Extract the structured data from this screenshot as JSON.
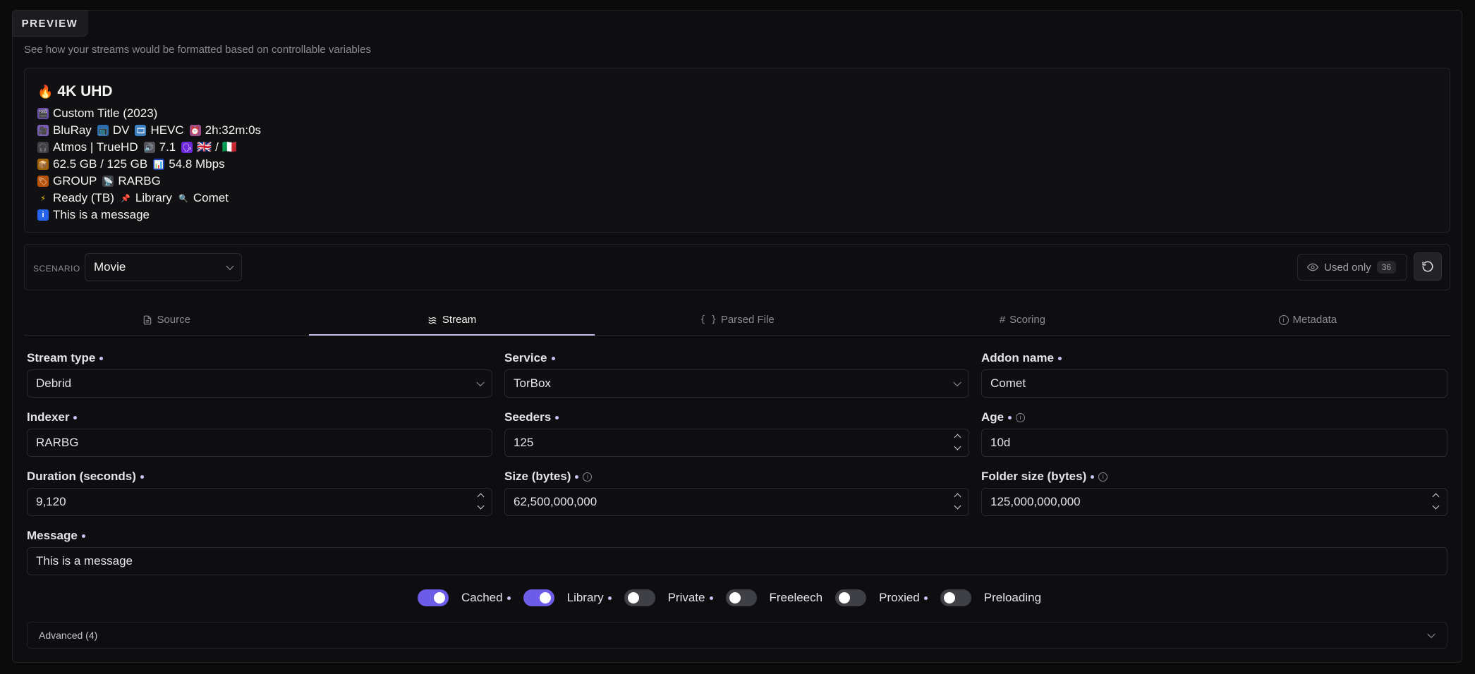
{
  "panel": {
    "tab_label": "PREVIEW",
    "subtitle": "See how your streams would be formatted based on controllable variables"
  },
  "preview": {
    "title": "4K UHD",
    "lines": [
      [
        "Custom Title (2023)"
      ],
      [
        "BluRay",
        "DV",
        "HEVC",
        "2h:32m:0s"
      ],
      [
        "Atmos | TrueHD",
        "7.1",
        "🇬🇧 / 🇮🇹"
      ],
      [
        "62.5 GB / 125 GB",
        "54.8 Mbps"
      ],
      [
        "GROUP",
        "RARBG"
      ],
      [
        "Ready (TB)",
        "Library",
        "Comet"
      ],
      [
        "This is a message"
      ]
    ]
  },
  "scenario": {
    "label": "SCENARIO",
    "value": "Movie",
    "used_only_label": "Used only",
    "used_only_count": "36"
  },
  "tabs": [
    {
      "label": "Source",
      "icon": "file-icon"
    },
    {
      "label": "Stream",
      "icon": "waves-icon",
      "active": true
    },
    {
      "label": "Parsed File",
      "icon": "braces-icon"
    },
    {
      "label": "Scoring",
      "icon": "hash-icon"
    },
    {
      "label": "Metadata",
      "icon": "info-icon"
    }
  ],
  "fields": {
    "stream_type": {
      "label": "Stream type",
      "value": "Debrid"
    },
    "service": {
      "label": "Service",
      "value": "TorBox"
    },
    "addon_name": {
      "label": "Addon name",
      "value": "Comet"
    },
    "indexer": {
      "label": "Indexer",
      "value": "RARBG"
    },
    "seeders": {
      "label": "Seeders",
      "value": "125"
    },
    "age": {
      "label": "Age",
      "value": "10d"
    },
    "duration": {
      "label": "Duration (seconds)",
      "value": "9,120"
    },
    "size": {
      "label": "Size (bytes)",
      "value": "62,500,000,000"
    },
    "folder_size": {
      "label": "Folder size (bytes)",
      "value": "125,000,000,000"
    },
    "message": {
      "label": "Message",
      "value": "This is a message"
    }
  },
  "toggles": [
    {
      "label": "Cached",
      "on": true
    },
    {
      "label": "Library",
      "on": true
    },
    {
      "label": "Private",
      "on": false
    },
    {
      "label": "Freeleech",
      "on": false
    },
    {
      "label": "Proxied",
      "on": false
    },
    {
      "label": "Preloading",
      "on": false
    }
  ],
  "advanced_label": "Advanced (4)",
  "colors": {
    "accent": "#6d5ce8",
    "tab_underline": "#c4c2f0",
    "dot": "#c7c5f5"
  }
}
